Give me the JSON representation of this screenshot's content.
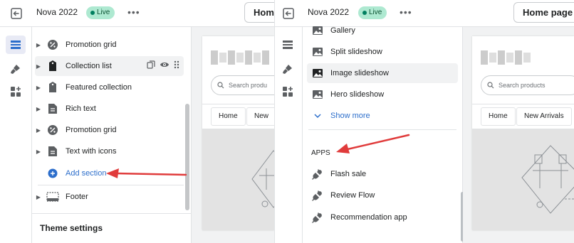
{
  "top_bar": {
    "store_name": "Nova 2022",
    "status_badge": "Live",
    "more": "•••",
    "page_select_left": "Hom",
    "page_select_right": "Home page"
  },
  "left_sidebar": {
    "sections": [
      {
        "label": "Promotion grid",
        "icon": "percent-icon"
      },
      {
        "label": "Collection list",
        "icon": "collection-icon",
        "hover": true
      },
      {
        "label": "Featured collection",
        "icon": "collection-icon"
      },
      {
        "label": "Rich text",
        "icon": "text-block-icon"
      },
      {
        "label": "Promotion grid",
        "icon": "percent-icon"
      },
      {
        "label": "Text with icons",
        "icon": "text-block-icon"
      }
    ],
    "add_section": "Add section",
    "footer": "Footer",
    "theme_settings": "Theme settings"
  },
  "right_sidebar": {
    "blocks": [
      {
        "label": "Gallery",
        "icon": "image-icon"
      },
      {
        "label": "Split slideshow",
        "icon": "image-icon"
      },
      {
        "label": "Image slideshow",
        "icon": "image-icon",
        "hover": true
      },
      {
        "label": "Hero slideshow",
        "icon": "image-icon"
      }
    ],
    "show_more": "Show more",
    "apps_heading": "APPS",
    "apps": [
      {
        "label": "Flash sale",
        "icon": "plug-icon"
      },
      {
        "label": "Review Flow",
        "icon": "plug-icon"
      },
      {
        "label": "Recommendation app",
        "icon": "plug-icon"
      }
    ]
  },
  "preview_left": {
    "search_placeholder": "Search produ",
    "nav_tabs": [
      "Home",
      "New"
    ]
  },
  "preview_right": {
    "search_placeholder": "Search products",
    "nav_tabs": [
      "Home",
      "New Arrivals"
    ]
  },
  "colors": {
    "accent_link": "#2c6ecb",
    "live_badge_bg": "#aee9d1",
    "annotation_arrow": "#e03b3b"
  }
}
